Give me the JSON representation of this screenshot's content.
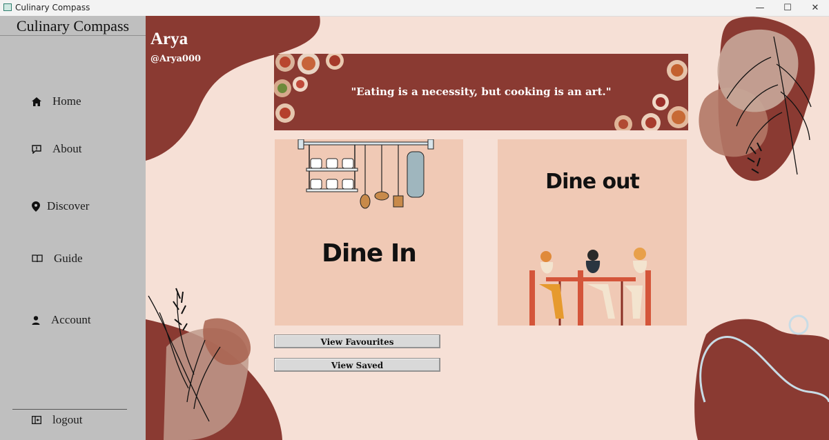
{
  "window": {
    "title": "Culinary Compass",
    "controls": {
      "minimize": "—",
      "maximize": "☐",
      "close": "✕"
    }
  },
  "sidebar": {
    "brand": "Culinary Compass",
    "items": [
      {
        "label": "Home",
        "icon": "home-icon"
      },
      {
        "label": "About",
        "icon": "about-icon"
      },
      {
        "label": "Discover",
        "icon": "location-pin-icon"
      },
      {
        "label": "Guide",
        "icon": "book-icon"
      },
      {
        "label": "Account",
        "icon": "user-icon"
      }
    ],
    "logout": {
      "label": "logout",
      "icon": "logout-icon"
    }
  },
  "user": {
    "name": "Arya",
    "handle": "@Arya000"
  },
  "banner": {
    "quote": "\"Eating is a necessity, but cooking is an art.\""
  },
  "cards": {
    "dine_in": "Dine In",
    "dine_out": "Dine out"
  },
  "buttons": {
    "favourites": "View Favourites",
    "saved": "View Saved"
  },
  "colors": {
    "background": "#f6e0d6",
    "accent": "#8a3a32",
    "sidebar": "#bfbfbf",
    "card": "#f0c9b5"
  }
}
